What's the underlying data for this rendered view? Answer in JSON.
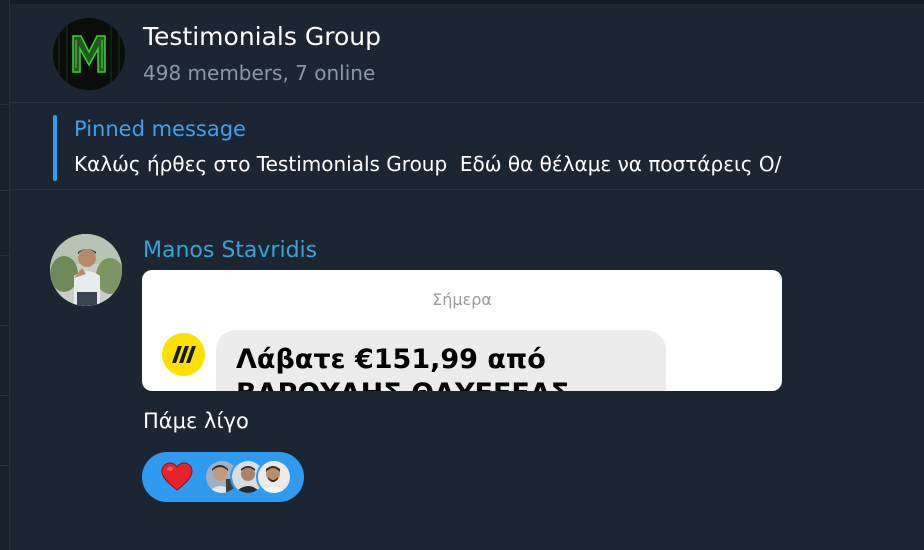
{
  "header": {
    "title": "Testimonials Group",
    "subtitle": "498 members, 7 online",
    "avatar_icon": "m-logo-icon",
    "avatar_colors": {
      "background": "#0a0d0a",
      "letter": "#3ecf3a"
    }
  },
  "pinned": {
    "label": "Pinned message",
    "text": "Καλώς ήρθες στο Testimonials Group  Εδώ θα θέλαμε να ποστάρεις Ο/"
  },
  "message": {
    "sender": "Manos Stavridis",
    "avatar_icon": "person-photo-avatar",
    "media": {
      "date": "Σήμερα",
      "line1": "Λάβατε €151,99 από",
      "line2": "ΒΑΡΟΥΑΗΣ ΘΑΥΕΕΕΑΣ",
      "bank_icon": "yellow-bank-logo-icon"
    },
    "text": "Πάμε λίγο",
    "reaction": {
      "emoji": "❤️",
      "icon": "heart-icon",
      "reactors": [
        "reactor-avatar-1",
        "reactor-avatar-2",
        "reactor-avatar-3"
      ]
    }
  },
  "colors": {
    "background": "#1c2532",
    "accent": "#2aa0f0",
    "sender_name": "#35a5d8",
    "reaction_pill": "#2e9bf0",
    "muted_text": "#8b97a6"
  }
}
